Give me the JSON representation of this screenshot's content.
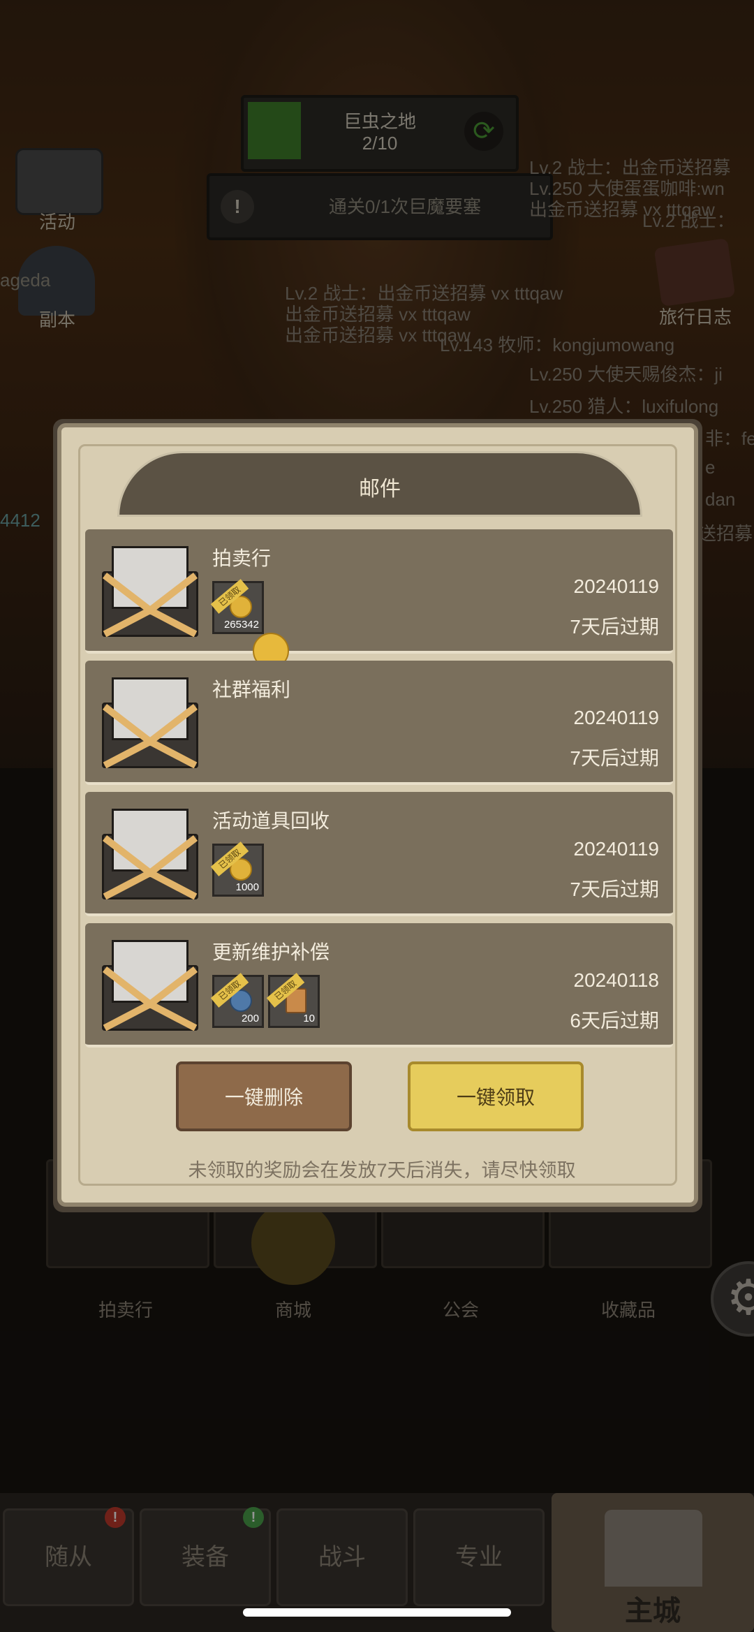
{
  "top": {
    "area_name": "巨虫之地",
    "area_progress": "2/10",
    "area_progress_fraction": 0.2,
    "quest_text": "通关0/1次巨魔要塞"
  },
  "side": {
    "left_top_label": "活动",
    "left_mid_label": "副本",
    "left_mid_overlay": "ageda",
    "right_label": "旅行日志"
  },
  "chat": {
    "lines_center": [
      "Lv.2 战士：出金币送招募 vx tttqaw",
      "出金币送招募 vx tttqaw",
      "出金币送招募 vx tttqaw"
    ],
    "lines_right": [
      "Lv.2 战士：出金币送招募",
      "Lv.250 大使蛋蛋咖啡:wn",
      "出金币送招募 vx tttqaw",
      "Lv.2 战士：",
      "Lv.143 牧师：kongjumowang",
      "Lv.250 大使天赐俊杰：ji",
      "Lv.250 猎人：luxifulong",
      "非：fe",
      "e",
      "dan",
      "送招募"
    ],
    "left_number": "4412"
  },
  "modal": {
    "title": "邮件",
    "mails": [
      {
        "sender": "拍卖行",
        "date": "20240119",
        "expire": "7天后过期",
        "rewards": [
          {
            "tag": "已领取",
            "qty": "265342",
            "icon": "coin-icon"
          }
        ]
      },
      {
        "sender": "社群福利",
        "date": "20240119",
        "expire": "7天后过期",
        "rewards": []
      },
      {
        "sender": "活动道具回收",
        "date": "20240119",
        "expire": "7天后过期",
        "rewards": [
          {
            "tag": "已领取",
            "qty": "1000",
            "icon": "coin-icon"
          }
        ]
      },
      {
        "sender": "更新维护补偿",
        "date": "20240118",
        "expire": "6天后过期",
        "rewards": [
          {
            "tag": "已领取",
            "qty": "200",
            "icon": "gem-icon"
          },
          {
            "tag": "已领取",
            "qty": "10",
            "icon": "scroll-icon"
          }
        ]
      }
    ],
    "delete_all_label": "一键删除",
    "claim_all_label": "一键领取",
    "hint": "未领取的奖励会在发放7天后消失，请尽快领取"
  },
  "grid": {
    "labels": [
      "拍卖行",
      "商城",
      "公会",
      "收藏品"
    ]
  },
  "tabs": {
    "items": [
      "随从",
      "装备",
      "战斗",
      "专业",
      "主城"
    ],
    "badge_followers": "!",
    "badge_equipment": "!"
  },
  "colors": {
    "accent_gold": "#e6cc5c",
    "delete_brown": "#8e6a4a",
    "modal_bg": "#d8cdb2",
    "mail_row": "#7a6f5c"
  }
}
